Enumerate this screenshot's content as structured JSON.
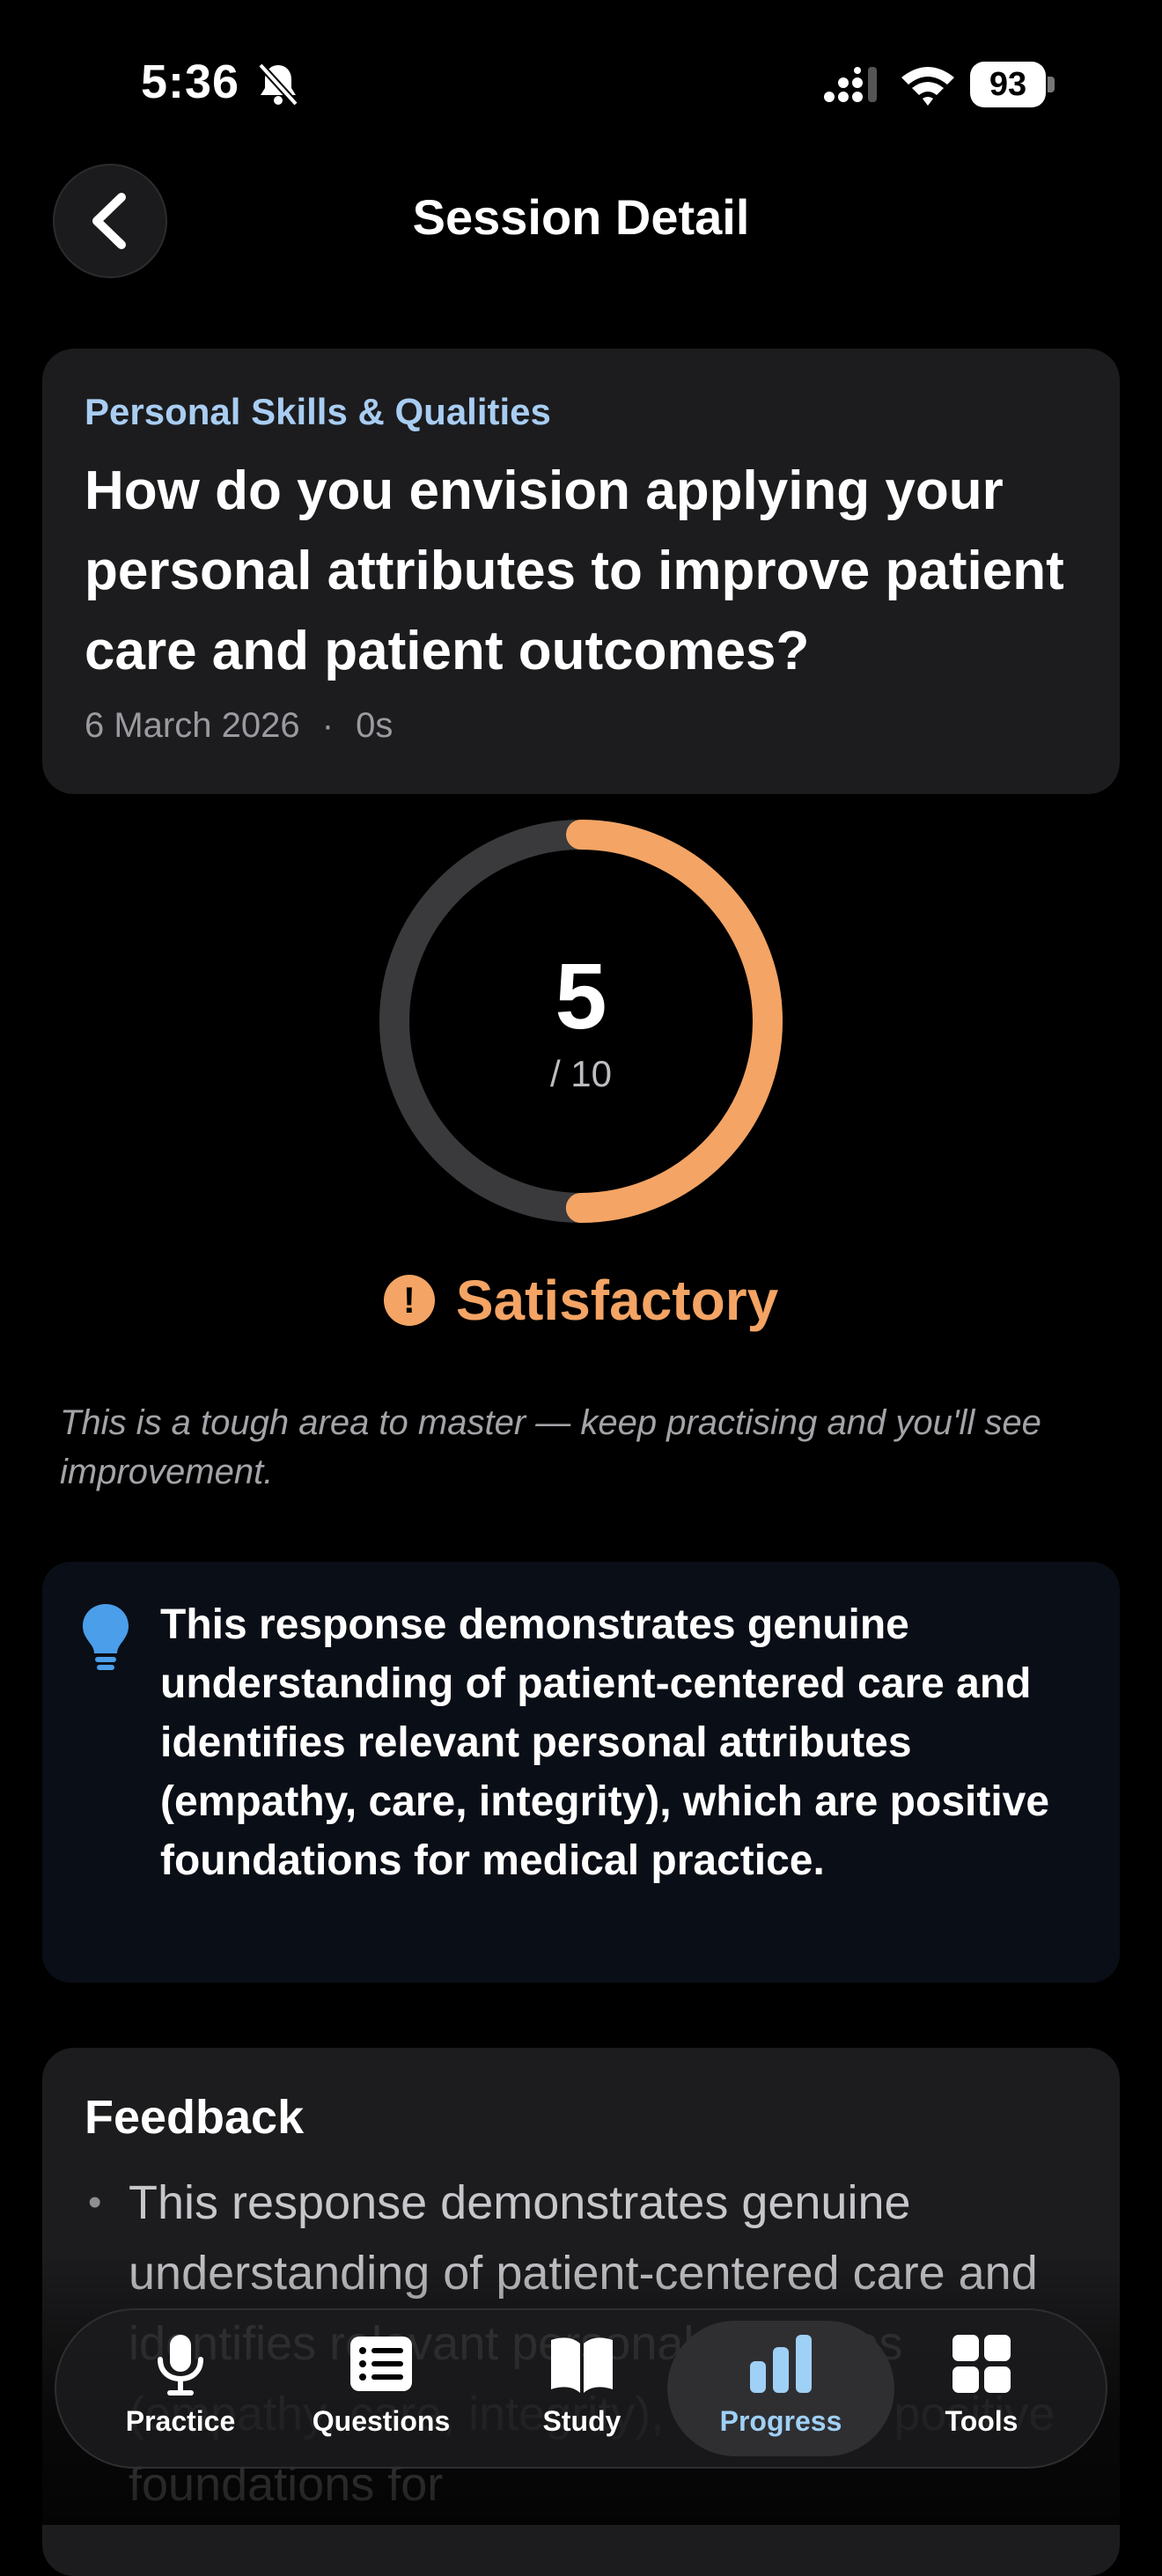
{
  "status_bar": {
    "time": "5:36",
    "battery": "93"
  },
  "header": {
    "title": "Session Detail"
  },
  "question": {
    "category": "Personal Skills & Qualities",
    "text": "How do you envision applying your personal attributes to improve patient care and patient outcomes?",
    "date": "6 March 2026",
    "separator": "·",
    "duration": "0s"
  },
  "score": {
    "value": "5",
    "max": "/ 10",
    "fraction": 0.5,
    "color": "#f4a464"
  },
  "rating": {
    "icon": "!",
    "label": "Satisfactory"
  },
  "encouragement": "This is a tough area to master — keep practising and you'll see improvement.",
  "summary": "This response demonstrates genuine understanding of patient-centered care and identifies relevant personal attributes (empathy, care, integrity), which are positive foundations for medical practice.",
  "feedback": {
    "title": "Feedback",
    "items": [
      "This response demonstrates genuine understanding of patient-centered care and identifies relevant personal attributes (empathy, care, integrity), which are positive foundations for"
    ]
  },
  "tabs": [
    {
      "label": "Practice"
    },
    {
      "label": "Questions"
    },
    {
      "label": "Study"
    },
    {
      "label": "Progress",
      "active": true
    },
    {
      "label": "Tools"
    }
  ]
}
